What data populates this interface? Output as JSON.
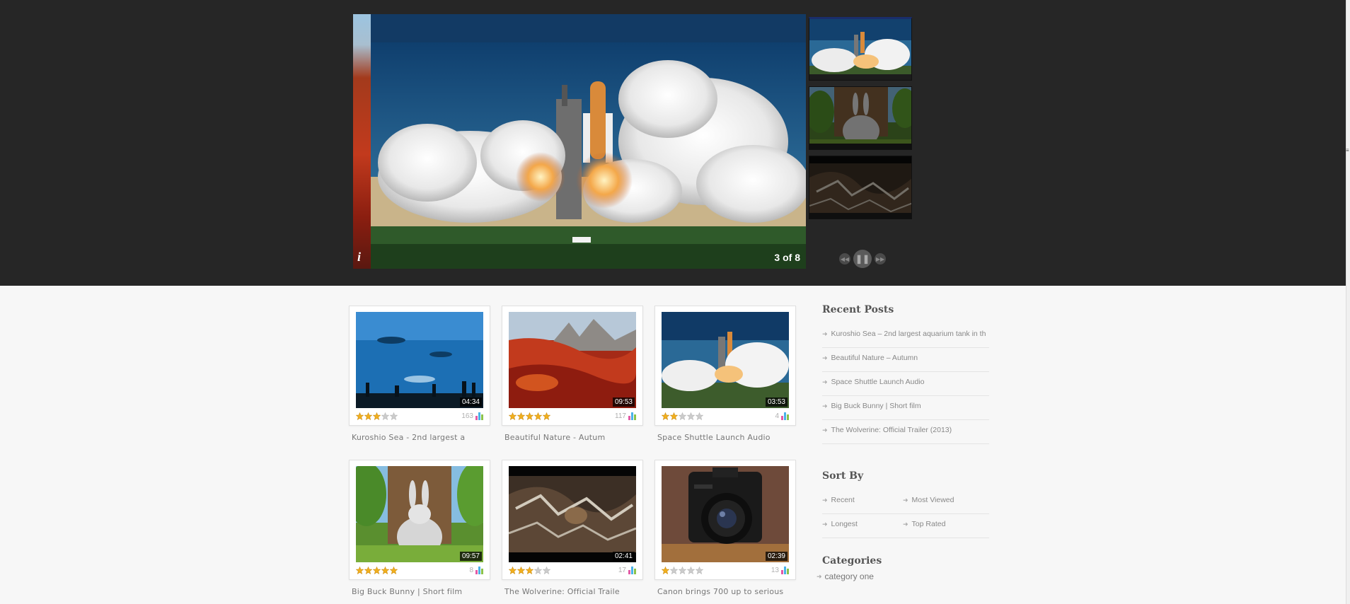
{
  "slider": {
    "counter": "3 of 8",
    "info_label": "i",
    "thumbnails": [
      {
        "name": "Space Shuttle Launch Audio",
        "active": true
      },
      {
        "name": "Big Buck Bunny",
        "active": false
      },
      {
        "name": "The Wolverine",
        "active": false
      }
    ],
    "controls": {
      "prev": "◀◀",
      "pause": "❚❚",
      "next": "▶▶"
    }
  },
  "videos": [
    {
      "title": "Kuroshio Sea - 2nd largest a",
      "duration": "04:34",
      "rating": 3,
      "views": "163"
    },
    {
      "title": "Beautiful Nature - Autum",
      "duration": "09:53",
      "rating": 5,
      "views": "117"
    },
    {
      "title": "Space Shuttle Launch Audio",
      "duration": "03:53",
      "rating": 2,
      "views": "4"
    },
    {
      "title": "Big Buck Bunny | Short film",
      "duration": "09:57",
      "rating": 5,
      "views": "8"
    },
    {
      "title": "The Wolverine: Official Traile",
      "duration": "02:41",
      "rating": 3,
      "views": "17"
    },
    {
      "title": "Canon brings 700 up to serious",
      "duration": "02:39",
      "rating": 1,
      "views": "13"
    }
  ],
  "sidebar": {
    "recent_posts": {
      "title": "Recent Posts",
      "items": [
        "Kuroshio Sea – 2nd largest aquarium tank in th",
        "Beautiful Nature – Autumn",
        "Space Shuttle Launch Audio",
        "Big Buck Bunny | Short film",
        "The Wolverine: Official Trailer (2013)"
      ]
    },
    "sort_by": {
      "title": "Sort By",
      "items": [
        "Recent",
        "Most Viewed",
        "Longest",
        "Top Rated"
      ]
    },
    "categories": {
      "title": "Categories",
      "items": [
        "category one"
      ]
    }
  },
  "colors": {
    "band_bg": "#262626",
    "page_bg": "#f7f7f7",
    "star_on": "#f2b01e",
    "star_off": "#cccccc"
  }
}
